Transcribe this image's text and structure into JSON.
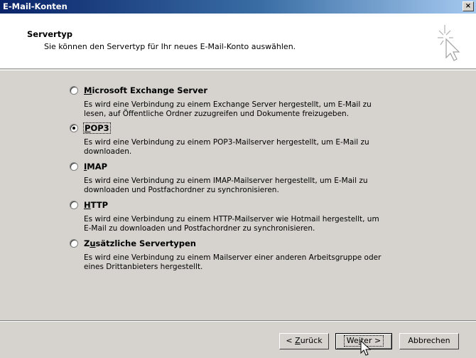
{
  "window": {
    "title": "E-Mail-Konten",
    "close_label": "×"
  },
  "header": {
    "heading": "Servertyp",
    "subtitle": "Sie können den Servertyp für Ihr neues E-Mail-Konto auswählen.",
    "icon": "wizard-star-cursor-icon"
  },
  "options": [
    {
      "label_access": "M",
      "label_rest": "icrosoft Exchange Server",
      "checked": false,
      "desc1": "Es wird eine Verbindung zu einem Exchange Server hergestellt, um E-Mail zu",
      "desc2": "lesen, auf Öffentliche Ordner zuzugreifen und Dokumente freizugeben."
    },
    {
      "label_access": "P",
      "label_rest": "OP3",
      "checked": true,
      "desc1": "Es wird eine Verbindung zu einem POP3-Mailserver hergestellt, um E-Mail zu",
      "desc2": "downloaden."
    },
    {
      "label_access": "I",
      "label_rest": "MAP",
      "checked": false,
      "desc1": "Es wird eine Verbindung zu einem IMAP-Mailserver hergestellt, um E-Mail zu",
      "desc2": "downloaden und Postfachordner zu synchronisieren."
    },
    {
      "label_access": "H",
      "label_rest": "TTP",
      "checked": false,
      "desc1": "Es wird eine Verbindung zu einem HTTP-Mailserver wie Hotmail hergestellt, um",
      "desc2": "E-Mail zu downloaden und Postfachordner zu synchronisieren."
    },
    {
      "label_pre": "Z",
      "label_access": "u",
      "label_rest": "sätzliche Servertypen",
      "checked": false,
      "desc1": "Es wird eine Verbindung zu einem Mailserver einer anderen Arbeitsgruppe oder",
      "desc2": "eines Drittanbieters hergestellt."
    }
  ],
  "buttons": {
    "back_pre": "< ",
    "back_access": "Z",
    "back_rest": "urück",
    "next_pre": "We",
    "next_access": "i",
    "next_rest": "ter >",
    "cancel": "Abbrechen"
  }
}
